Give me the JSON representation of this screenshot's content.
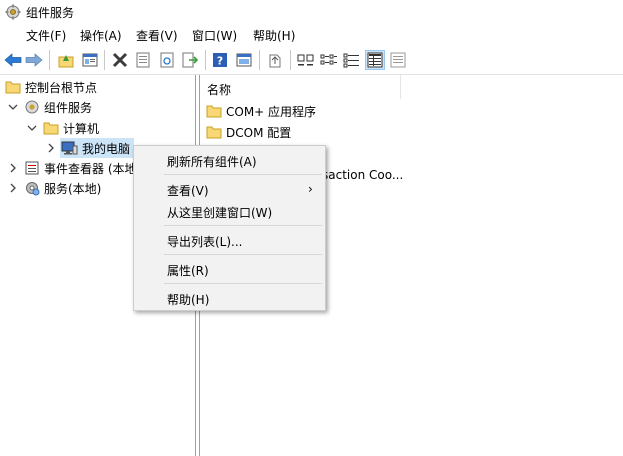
{
  "window": {
    "title": "组件服务"
  },
  "menu": [
    "文件(F)",
    "操作(A)",
    "查看(V)",
    "窗口(W)",
    "帮助(H)"
  ],
  "toolbar": {
    "buttons": [
      "back-icon",
      "forward-icon",
      "up-folder-icon",
      "show-tree-icon",
      "delete-icon",
      "properties-icon",
      "refresh-icon",
      "export-icon",
      "help-icon",
      "console-tree-icon",
      "new-window-icon",
      "large-icons-icon",
      "small-icons-icon",
      "list-view-icon",
      "details-view-icon",
      "status-view-icon"
    ],
    "active": "details-view-icon"
  },
  "tree": {
    "root": "控制台根节点",
    "component_services": "组件服务",
    "computers": "计算机",
    "my_computer": "我的电脑",
    "event_viewer": "事件查看器 (本地)",
    "services": "服务(本地)"
  },
  "list": {
    "column_name": "名称",
    "items": [
      "COM+ 应用程序",
      "DCOM 配置",
      "Distributed Transaction Coo..."
    ]
  },
  "context_menu": {
    "items": [
      "刷新所有组件(A)",
      "查看(V)",
      "从这里创建窗口(W)",
      "导出列表(L)...",
      "属性(R)",
      "帮助(H)"
    ],
    "submenu_arrow": "›"
  },
  "colors": {
    "selection": "#cce4f7",
    "folder": "#f8d775",
    "menu_bg": "#f2f2f2"
  }
}
